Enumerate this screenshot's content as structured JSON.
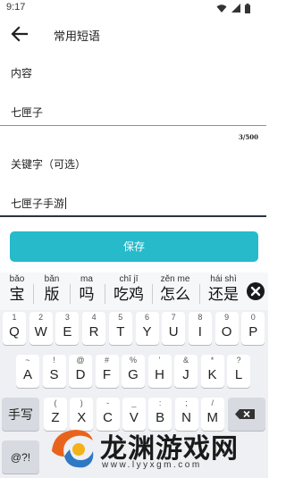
{
  "status_bar": {
    "time": "9:17",
    "icons": [
      "wifi-icon",
      "signal-icon",
      "battery-icon"
    ]
  },
  "app_bar": {
    "back_icon": "arrow-left-icon",
    "title": "常用短语"
  },
  "form": {
    "content_label": "内容",
    "content_value": "七匣子",
    "counter": "3/500",
    "keyword_label": "关键字（可选）",
    "keyword_value": "七匣子手游",
    "save_label": "保存"
  },
  "keyboard": {
    "candidates": [
      {
        "pinyin": "bǎo",
        "hanzi": "宝"
      },
      {
        "pinyin": "bǎn",
        "hanzi": "版"
      },
      {
        "pinyin": "ma",
        "hanzi": "吗"
      },
      {
        "pinyin": "chī jī",
        "hanzi": "吃鸡"
      },
      {
        "pinyin": "zěn me",
        "hanzi": "怎么"
      },
      {
        "pinyin": "hái shì",
        "hanzi": "还是"
      }
    ],
    "row1": [
      {
        "main": "Q",
        "sub": "1"
      },
      {
        "main": "W",
        "sub": "2"
      },
      {
        "main": "E",
        "sub": "3"
      },
      {
        "main": "R",
        "sub": "4"
      },
      {
        "main": "T",
        "sub": "5"
      },
      {
        "main": "Y",
        "sub": "6"
      },
      {
        "main": "U",
        "sub": "7"
      },
      {
        "main": "I",
        "sub": "8"
      },
      {
        "main": "O",
        "sub": "9"
      },
      {
        "main": "P",
        "sub": "0"
      }
    ],
    "row2": [
      {
        "main": "A",
        "sub": "~"
      },
      {
        "main": "S",
        "sub": "!"
      },
      {
        "main": "D",
        "sub": "@"
      },
      {
        "main": "F",
        "sub": "#"
      },
      {
        "main": "G",
        "sub": "%"
      },
      {
        "main": "H",
        "sub": "'"
      },
      {
        "main": "J",
        "sub": "&"
      },
      {
        "main": "K",
        "sub": "*"
      },
      {
        "main": "L",
        "sub": "?"
      }
    ],
    "row3": [
      {
        "main": "Z",
        "sub": "("
      },
      {
        "main": "X",
        "sub": ")"
      },
      {
        "main": "C",
        "sub": "-"
      },
      {
        "main": "V",
        "sub": "_"
      },
      {
        "main": "B",
        "sub": ":"
      },
      {
        "main": "N",
        "sub": ";"
      },
      {
        "main": "M",
        "sub": "/"
      }
    ],
    "handwriting_label": "手写",
    "symbols_label": "@?!",
    "delete_icon": "backspace-icon"
  },
  "watermark": {
    "title": "龙渊游戏网",
    "url": "www.lyyxgm.com"
  },
  "colors": {
    "accent": "#26bacb",
    "keyboard_bg": "#eef0f4"
  }
}
